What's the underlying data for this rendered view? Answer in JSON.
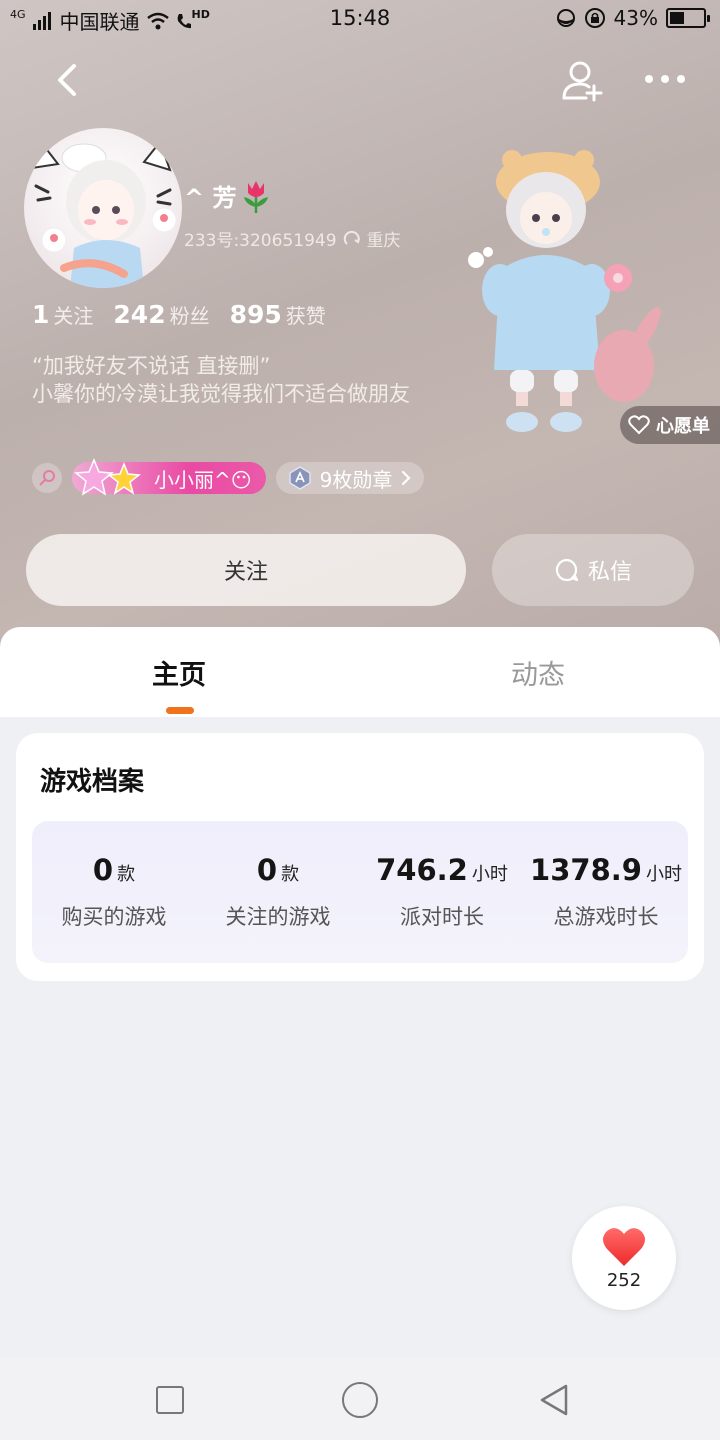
{
  "status_bar": {
    "network": "4G",
    "carrier": "中国联通",
    "hd": "HD",
    "time": "15:48",
    "battery": "43%",
    "battery_level": 0.43
  },
  "profile": {
    "username": "^ 芳",
    "uid": "233号:320651949",
    "location": "重庆",
    "stats": [
      {
        "value": "1",
        "label": "关注"
      },
      {
        "value": "242",
        "label": "粉丝"
      },
      {
        "value": "895",
        "label": "获赞"
      }
    ],
    "bio_line1": "“加我好友不说话 直接删”",
    "bio_line2": "小馨你的冷漠让我觉得我们不适合做朋友",
    "badge_name": "小小丽^😶",
    "badge_medals": "9枚勋章",
    "wishlist": "心愿单"
  },
  "actions": {
    "follow": "关注",
    "message": "私信"
  },
  "tabs": [
    {
      "label": "主页",
      "active": true
    },
    {
      "label": "动态",
      "active": false
    }
  ],
  "game_profile": {
    "title": "游戏档案",
    "stats": [
      {
        "value": "0",
        "unit": "款",
        "label": "购买的游戏"
      },
      {
        "value": "0",
        "unit": "款",
        "label": "关注的游戏"
      },
      {
        "value": "746.2",
        "unit": "小时",
        "label": "派对时长"
      },
      {
        "value": "1378.9",
        "unit": "小时",
        "label": "总游戏时长"
      }
    ]
  },
  "like_count": "252",
  "colors": {
    "accent": "#f0731c",
    "badge_pink": "#e94aa4",
    "heart_red": "#f23b3b"
  }
}
